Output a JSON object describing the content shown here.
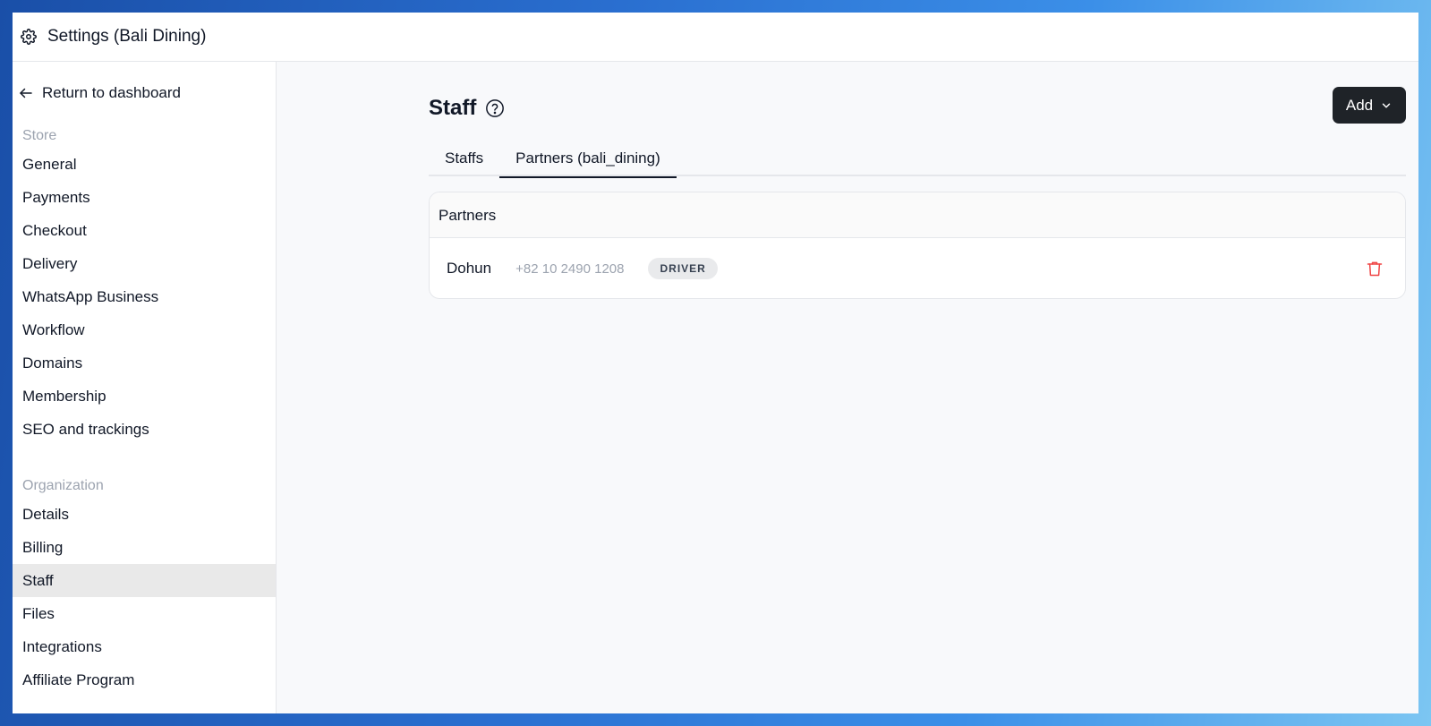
{
  "window": {
    "title": "Settings (Bali Dining)",
    "title_icon": "gear-icon"
  },
  "sidebar": {
    "back_label": "Return to dashboard",
    "back_icon": "arrow-left-icon",
    "store_section": {
      "title": "Store",
      "items": [
        "General",
        "Payments",
        "Checkout",
        "Delivery",
        "WhatsApp Business",
        "Workflow",
        "Domains",
        "Membership",
        "SEO and trackings"
      ]
    },
    "org_section": {
      "title": "Organization",
      "items": [
        "Details",
        "Billing",
        "Staff",
        "Files",
        "Integrations",
        "Affiliate Program"
      ]
    },
    "active_item": "Staff"
  },
  "main": {
    "page_title": "Staff",
    "help_icon": "question-circle-icon",
    "add_button": {
      "label": "Add",
      "icon": "chevron-down-icon"
    },
    "tabs": [
      {
        "label": "Staffs",
        "active": false
      },
      {
        "label": "Partners (bali_dining)",
        "active": true
      }
    ],
    "partners_card": {
      "header": "Partners",
      "rows": [
        {
          "name": "Dohun",
          "phone": "+82 10 2490 1208",
          "role": "DRIVER",
          "delete_icon": "trash-icon"
        }
      ]
    }
  },
  "colors": {
    "accent_dark": "#1f2328",
    "delete_red": "#ef4444",
    "active_nav_bg": "#e9e9e9",
    "main_bg": "#f8f9fb"
  }
}
